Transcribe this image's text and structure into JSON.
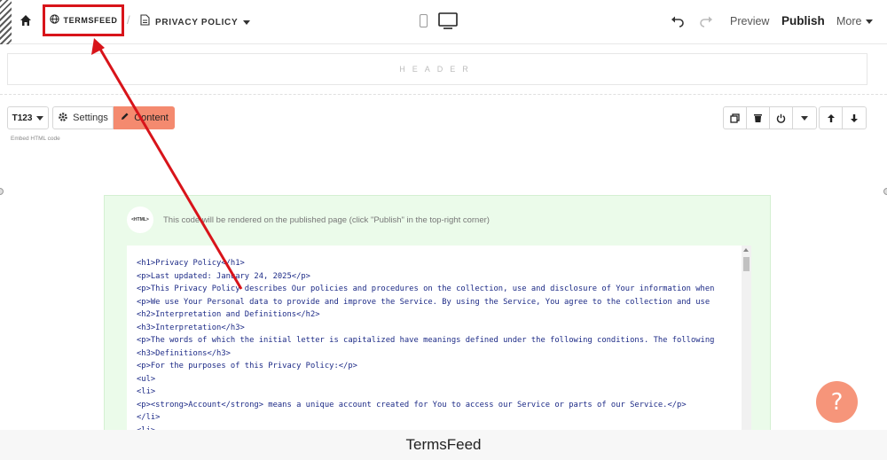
{
  "topbar": {
    "site_label": "TERMSFEED",
    "separator": "/",
    "page_label": "PRIVACY POLICY",
    "preview_label": "Preview",
    "publish_label": "Publish",
    "more_label": "More"
  },
  "header_block": {
    "label": "HEADER"
  },
  "block_toolbar": {
    "block_id": "T123",
    "settings_label": "Settings",
    "content_label": "Content",
    "caption": "Embed HTML code"
  },
  "embed": {
    "badge": "<HTML>",
    "notice": "This code will be rendered on the published page (click \"Publish\" in the top-right corner)",
    "code_lines": [
      "<h1>Privacy Policy</h1>",
      "<p>Last updated: January 24, 2025</p>",
      "<p>This Privacy Policy describes Our policies and procedures on the collection, use and disclosure of Your information when",
      "<p>We use Your Personal data to provide and improve the Service. By using the Service, You agree to the collection and use",
      "<h2>Interpretation and Definitions</h2>",
      "<h3>Interpretation</h3>",
      "<p>The words of which the initial letter is capitalized have meanings defined under the following conditions. The following",
      "<h3>Definitions</h3>",
      "<p>For the purposes of this Privacy Policy:</p>",
      "<ul>",
      "<li>",
      "<p><strong>Account</strong> means a unique account created for You to access our Service or parts of our Service.</p>",
      "</li>",
      "<li>"
    ]
  },
  "help": {
    "label": "?"
  },
  "caption": "TermsFeed",
  "colors": {
    "accent": "#f48a6f",
    "highlight": "#d8141a",
    "panel_bg": "#ebfbea",
    "code_text": "#1c2a86"
  }
}
